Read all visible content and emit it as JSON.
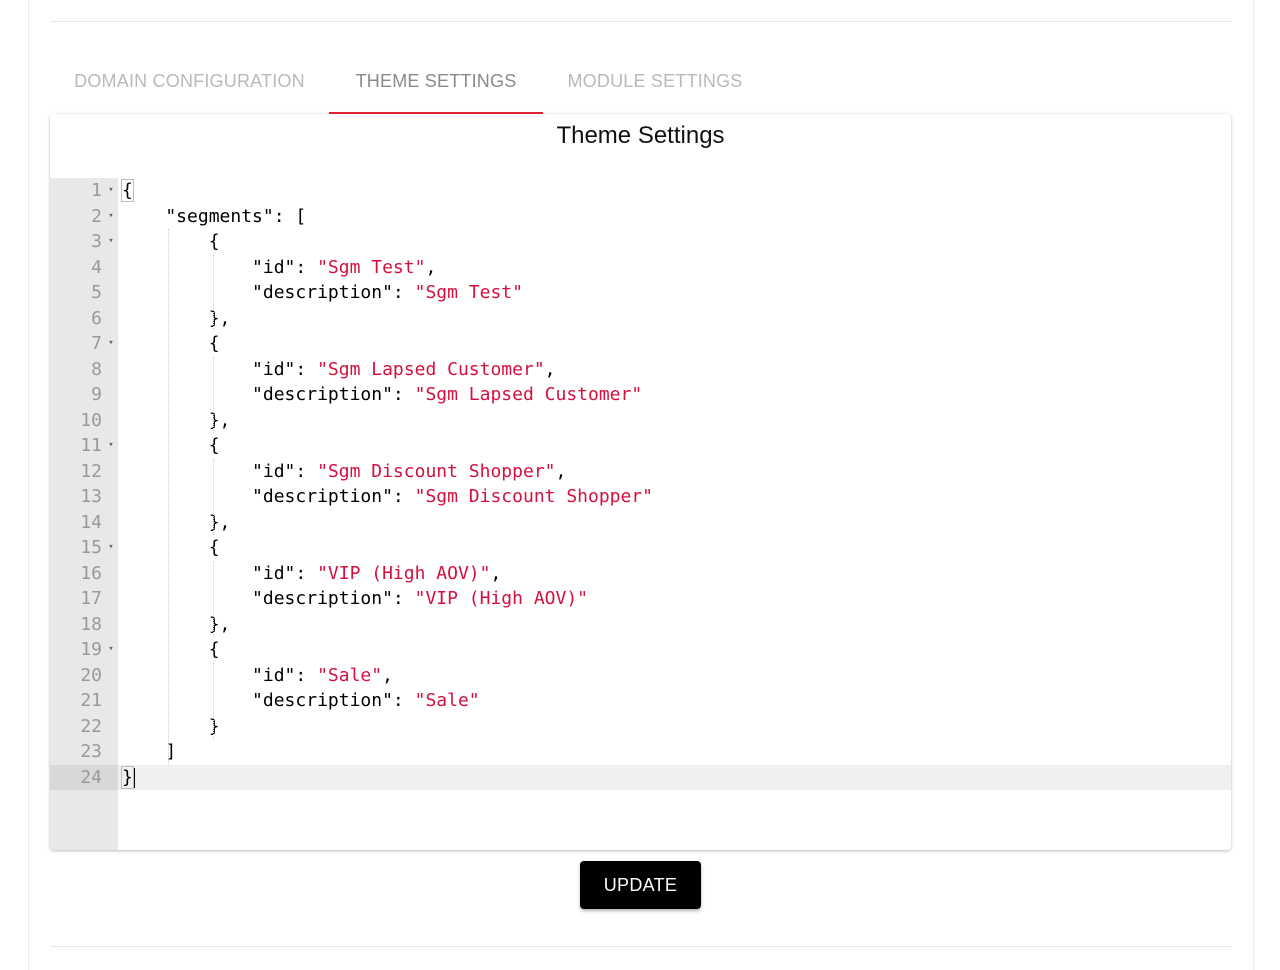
{
  "tabs": [
    {
      "label": "DOMAIN CONFIGURATION",
      "active": false
    },
    {
      "label": "THEME SETTINGS",
      "active": true
    },
    {
      "label": "MODULE SETTINGS",
      "active": false
    }
  ],
  "panel": {
    "title": "Theme Settings"
  },
  "editor": {
    "lines": [
      {
        "n": "1",
        "fold": true,
        "parts": [
          {
            "t": "{",
            "c": "p"
          }
        ]
      },
      {
        "n": "2",
        "fold": true,
        "parts": [
          {
            "t": "    \"segments\": [",
            "c": "p"
          }
        ]
      },
      {
        "n": "3",
        "fold": true,
        "parts": [
          {
            "t": "        {",
            "c": "p"
          }
        ]
      },
      {
        "n": "4",
        "fold": false,
        "parts": [
          {
            "t": "            \"id\": ",
            "c": "p"
          },
          {
            "t": "\"Sgm Test\"",
            "c": "s"
          },
          {
            "t": ",",
            "c": "p"
          }
        ]
      },
      {
        "n": "5",
        "fold": false,
        "parts": [
          {
            "t": "            \"description\": ",
            "c": "p"
          },
          {
            "t": "\"Sgm Test\"",
            "c": "s"
          }
        ]
      },
      {
        "n": "6",
        "fold": false,
        "parts": [
          {
            "t": "        },",
            "c": "p"
          }
        ]
      },
      {
        "n": "7",
        "fold": true,
        "parts": [
          {
            "t": "        {",
            "c": "p"
          }
        ]
      },
      {
        "n": "8",
        "fold": false,
        "parts": [
          {
            "t": "            \"id\": ",
            "c": "p"
          },
          {
            "t": "\"Sgm Lapsed Customer\"",
            "c": "s"
          },
          {
            "t": ",",
            "c": "p"
          }
        ]
      },
      {
        "n": "9",
        "fold": false,
        "parts": [
          {
            "t": "            \"description\": ",
            "c": "p"
          },
          {
            "t": "\"Sgm Lapsed Customer\"",
            "c": "s"
          }
        ]
      },
      {
        "n": "10",
        "fold": false,
        "parts": [
          {
            "t": "        },",
            "c": "p"
          }
        ]
      },
      {
        "n": "11",
        "fold": true,
        "parts": [
          {
            "t": "        {",
            "c": "p"
          }
        ]
      },
      {
        "n": "12",
        "fold": false,
        "parts": [
          {
            "t": "            \"id\": ",
            "c": "p"
          },
          {
            "t": "\"Sgm Discount Shopper\"",
            "c": "s"
          },
          {
            "t": ",",
            "c": "p"
          }
        ]
      },
      {
        "n": "13",
        "fold": false,
        "parts": [
          {
            "t": "            \"description\": ",
            "c": "p"
          },
          {
            "t": "\"Sgm Discount Shopper\"",
            "c": "s"
          }
        ]
      },
      {
        "n": "14",
        "fold": false,
        "parts": [
          {
            "t": "        },",
            "c": "p"
          }
        ]
      },
      {
        "n": "15",
        "fold": true,
        "parts": [
          {
            "t": "        {",
            "c": "p"
          }
        ]
      },
      {
        "n": "16",
        "fold": false,
        "parts": [
          {
            "t": "            \"id\": ",
            "c": "p"
          },
          {
            "t": "\"VIP (High AOV)\"",
            "c": "s"
          },
          {
            "t": ",",
            "c": "p"
          }
        ]
      },
      {
        "n": "17",
        "fold": false,
        "parts": [
          {
            "t": "            \"description\": ",
            "c": "p"
          },
          {
            "t": "\"VIP (High AOV)\"",
            "c": "s"
          }
        ]
      },
      {
        "n": "18",
        "fold": false,
        "parts": [
          {
            "t": "        },",
            "c": "p"
          }
        ]
      },
      {
        "n": "19",
        "fold": true,
        "parts": [
          {
            "t": "        {",
            "c": "p"
          }
        ]
      },
      {
        "n": "20",
        "fold": false,
        "parts": [
          {
            "t": "            \"id\": ",
            "c": "p"
          },
          {
            "t": "\"Sale\"",
            "c": "s"
          },
          {
            "t": ",",
            "c": "p"
          }
        ]
      },
      {
        "n": "21",
        "fold": false,
        "parts": [
          {
            "t": "            \"description\": ",
            "c": "p"
          },
          {
            "t": "\"Sale\"",
            "c": "s"
          }
        ]
      },
      {
        "n": "22",
        "fold": false,
        "parts": [
          {
            "t": "        }",
            "c": "p"
          }
        ]
      },
      {
        "n": "23",
        "fold": false,
        "parts": [
          {
            "t": "    ]",
            "c": "p"
          }
        ]
      },
      {
        "n": "24",
        "fold": false,
        "active": true,
        "parts": [
          {
            "t": "}",
            "c": "p"
          }
        ]
      }
    ]
  },
  "actions": {
    "update_label": "UPDATE"
  },
  "colors": {
    "accent": "#e8233a",
    "string": "#d4103f",
    "button": "#000000"
  }
}
